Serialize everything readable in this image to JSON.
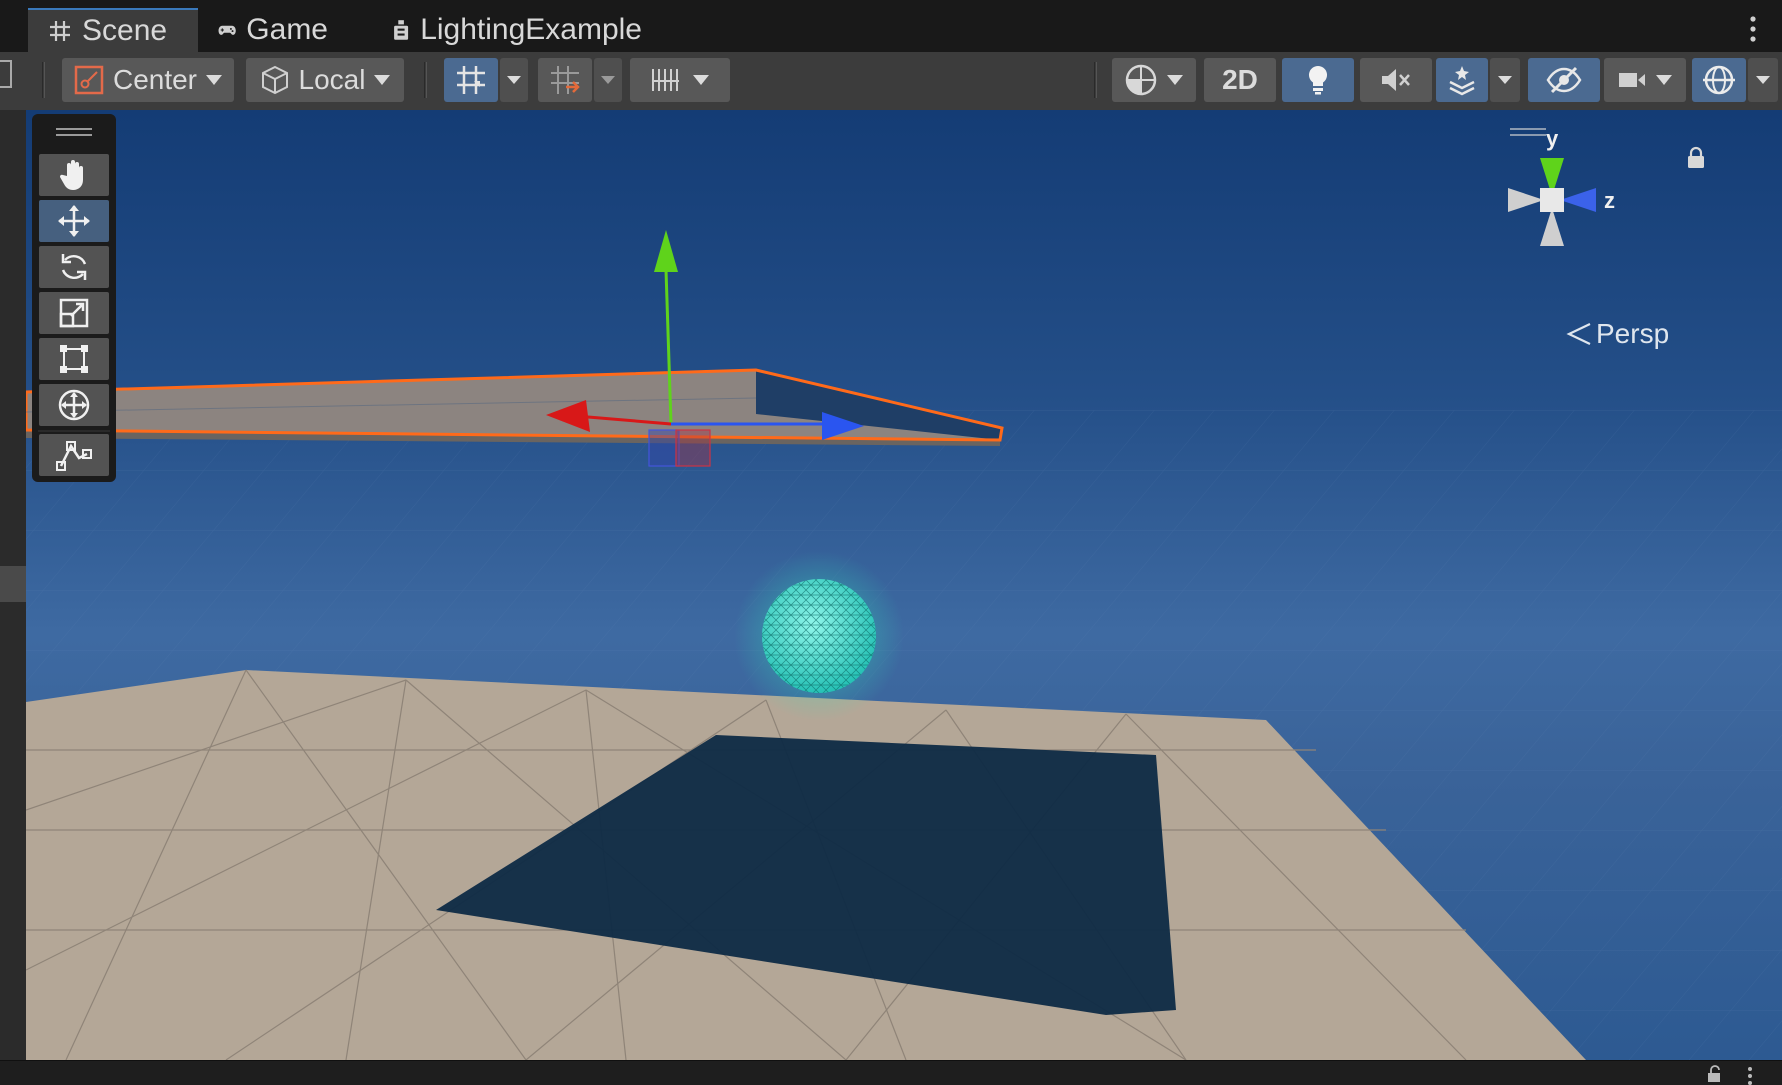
{
  "tabs": [
    {
      "label": "Scene",
      "icon": "grid-hash-icon",
      "active": true
    },
    {
      "label": "Game",
      "icon": "gamepad-icon",
      "active": false
    },
    {
      "label": "LightingExample",
      "icon": "tree-icon",
      "active": false
    }
  ],
  "toolbar": {
    "pivot_label": "Center",
    "rotation_label": "Local",
    "mode_2d_label": "2D"
  },
  "gizmo": {
    "y_label": "y",
    "z_label": "z",
    "projection_label": "Persp"
  },
  "colors": {
    "accent": "#3a79bb",
    "selection_outline": "#ff6a1a",
    "axis_x": "#d81818",
    "axis_y": "#5fd31b",
    "axis_z": "#2a55f0",
    "sphere": "#3fe0c8"
  }
}
